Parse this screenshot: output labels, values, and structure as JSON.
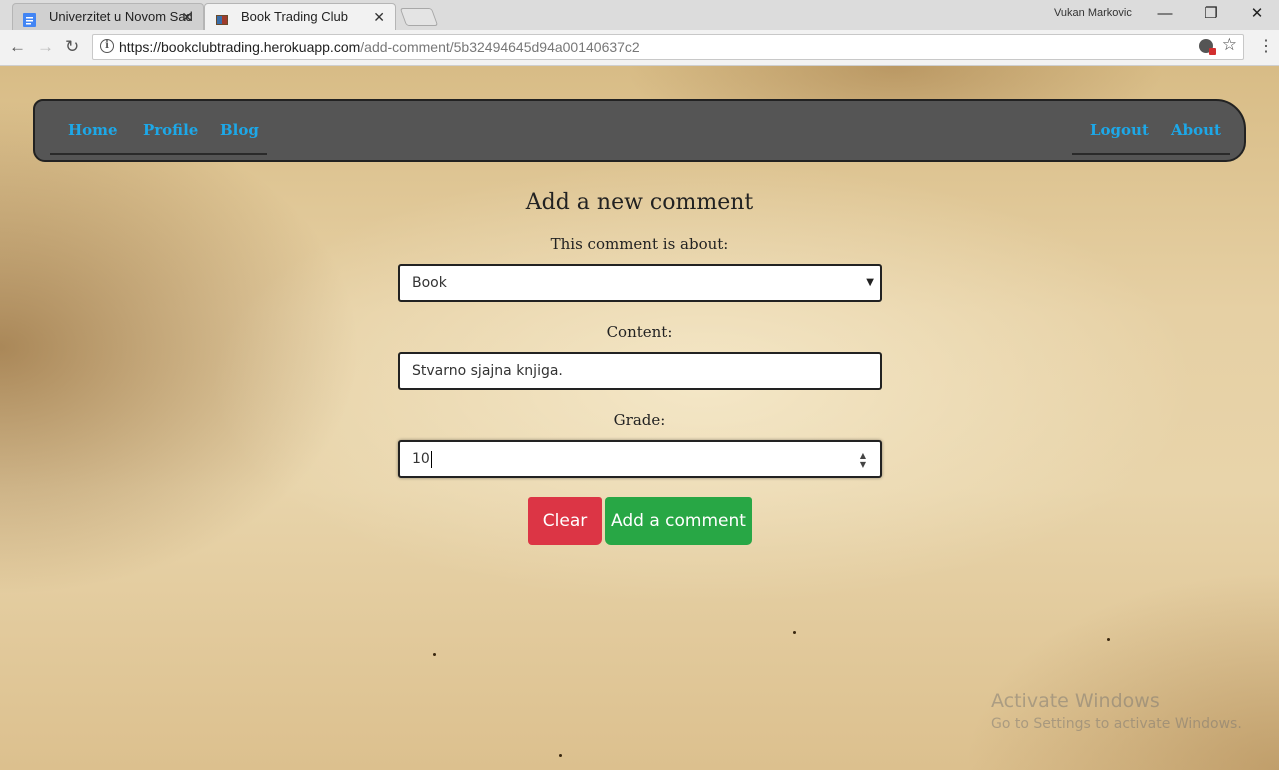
{
  "browser": {
    "tabs": [
      {
        "title": "Univerzitet u Novom Sad",
        "active": false
      },
      {
        "title": "Book Trading Club",
        "active": true
      }
    ],
    "user": "Vukan Markovic",
    "window_buttons": {
      "minimize": "—",
      "restore": "❐",
      "close": "✕"
    },
    "url_host": "https://bookclubtrading.herokuapp.com",
    "url_path": "/add-comment/5b32494645d94a00140637c2"
  },
  "navbar": {
    "left_links": [
      "Home",
      "Profile",
      "Blog"
    ],
    "right_links": [
      "Logout",
      "About"
    ],
    "link_color": "#1da8e8"
  },
  "form": {
    "title": "Add a new comment",
    "about_label": "This comment is about:",
    "about_value": "Book",
    "content_label": "Content:",
    "content_value": "Stvarno sjajna knjiga.",
    "grade_label": "Grade:",
    "grade_value": "10",
    "clear_label": "Clear",
    "submit_label": "Add a comment"
  },
  "colors": {
    "danger": "#dc3545",
    "success": "#28a745",
    "navbar": "#555555"
  },
  "watermark": {
    "title": "Activate Windows",
    "subtitle": "Go to Settings to activate Windows."
  }
}
